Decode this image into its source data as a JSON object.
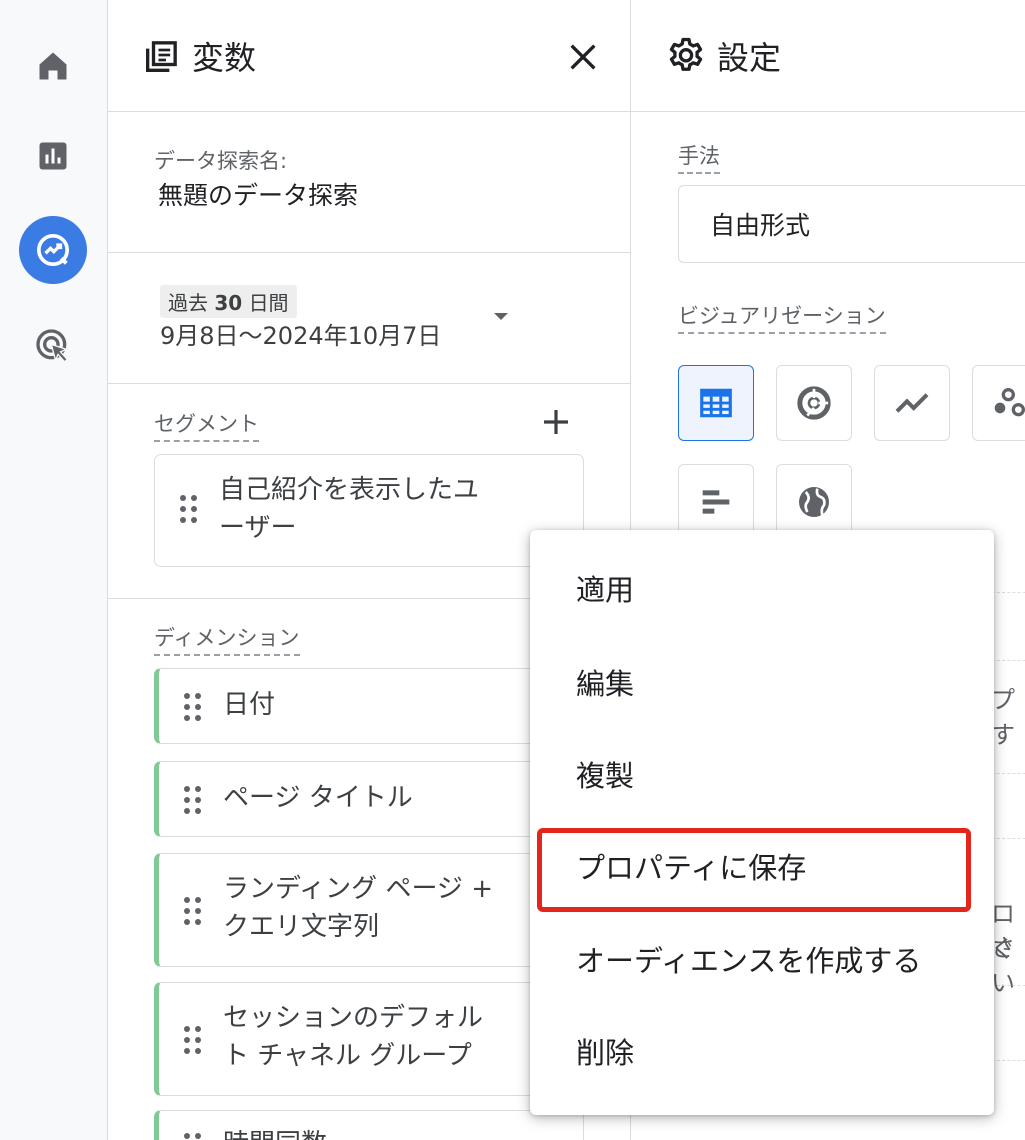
{
  "rail": {
    "items": [
      {
        "icon": "home-icon"
      },
      {
        "icon": "reports-icon"
      },
      {
        "icon": "explore-icon",
        "active": true
      },
      {
        "icon": "advertising-icon"
      }
    ],
    "accent": "#3b7be4"
  },
  "variables_panel": {
    "title": "変数",
    "exploration_name_label": "データ探索名:",
    "exploration_name": "無題のデータ探索",
    "date_range": {
      "preset_prefix": "過去",
      "preset_number": "30",
      "preset_suffix": "日間",
      "range": "9月8日～2024年10月7日"
    },
    "segments": {
      "label": "セグメント",
      "items": [
        {
          "line1": "自己紹介を表示したユ",
          "line2": "ーザー"
        }
      ]
    },
    "dimensions": {
      "label": "ディメンション",
      "accent": "#81c995",
      "items": [
        {
          "line1": "日付",
          "line2": ""
        },
        {
          "line1": "ページ タイトル",
          "line2": ""
        },
        {
          "line1": "ランディング ページ +",
          "line2": "クエリ文字列"
        },
        {
          "line1": "セッションのデフォル",
          "line2": "ト チャネル グループ"
        },
        {
          "line1": "時間同数",
          "line2": ""
        }
      ]
    }
  },
  "settings_panel": {
    "title": "設定",
    "technique_label": "手法",
    "technique_value": "自由形式",
    "visualization_label": "ビジュアリゼーション",
    "visualizations": [
      "table-icon",
      "donut-chart-icon",
      "line-chart-icon",
      "scatter-icon",
      "bar-chart-icon",
      "geo-map-icon"
    ],
    "clipped": [
      "プす",
      "ロぐ",
      "さい"
    ]
  },
  "context_menu": {
    "items": [
      "適用",
      "編集",
      "複製",
      "プロパティに保存",
      "オーディエンスを作成する",
      "削除"
    ],
    "highlighted_index": 3,
    "highlight_color": "#e3261b"
  }
}
